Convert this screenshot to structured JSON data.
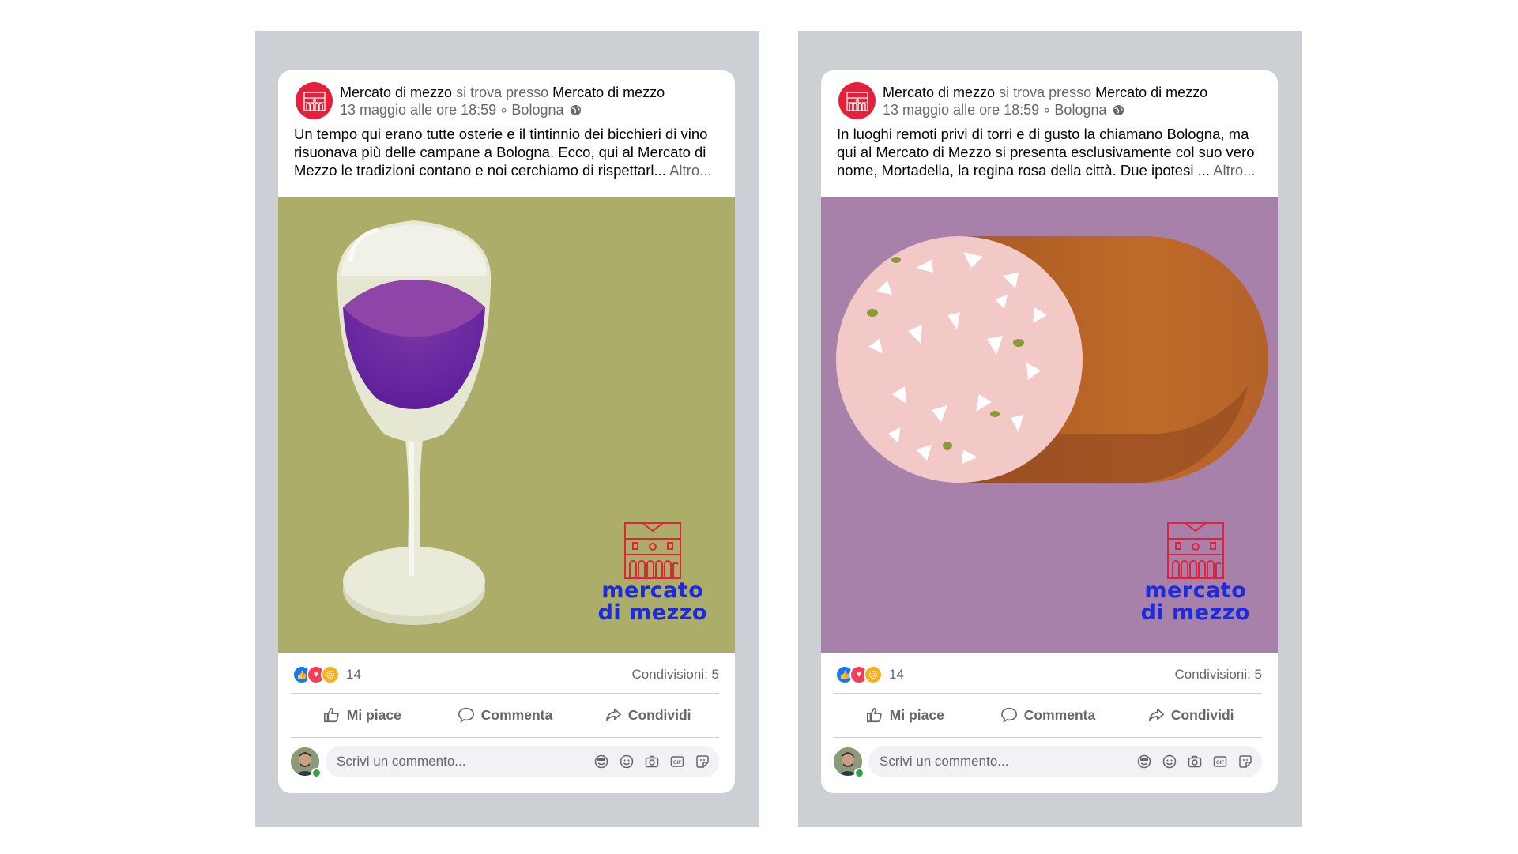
{
  "colors": {
    "brand_red": "#e5203a",
    "brand_blue": "#1a2be0",
    "panel_gray": "#ccd0d4"
  },
  "posts": [
    {
      "page_name": "Mercato di mezzo",
      "location_connector": "si trova presso",
      "location_name": "Mercato di mezzo",
      "timestamp": "13 maggio alle ore 18:59",
      "separator": "∘",
      "city": "Bologna",
      "text": "Un tempo qui erano tutte osterie e il tintinnio dei bicchieri di vino risuonava più delle campane a Bologna. Ecco, qui al Mercato di Mezzo le tradizioni contano e noi cerchiamo di rispettarl...",
      "more_label": "Altro...",
      "image_subject": "wine-glass-illustration",
      "brand_line1": "mercato",
      "brand_line2": "di mezzo",
      "reaction_count": "14",
      "shares_label": "Condivisioni: 5",
      "like_label": "Mi piace",
      "comment_label": "Commenta",
      "share_label": "Condividi",
      "comment_placeholder": "Scrivi un commento..."
    },
    {
      "page_name": "Mercato di mezzo",
      "location_connector": "si trova presso",
      "location_name": "Mercato di mezzo",
      "timestamp": "13 maggio alle ore 18:59",
      "separator": "∘",
      "city": "Bologna",
      "text": "In luoghi remoti privi di torri e di gusto la chiamano Bologna, ma qui al Mercato di Mezzo si presenta esclusivamente col suo vero nome, Mortadella, la regina rosa della città. Due ipotesi ...",
      "more_label": "Altro...",
      "image_subject": "mortadella-illustration",
      "brand_line1": "mercato",
      "brand_line2": "di mezzo",
      "reaction_count": "14",
      "shares_label": "Condivisioni: 5",
      "like_label": "Mi piace",
      "comment_label": "Commenta",
      "share_label": "Condividi",
      "comment_placeholder": "Scrivi un commento..."
    }
  ]
}
